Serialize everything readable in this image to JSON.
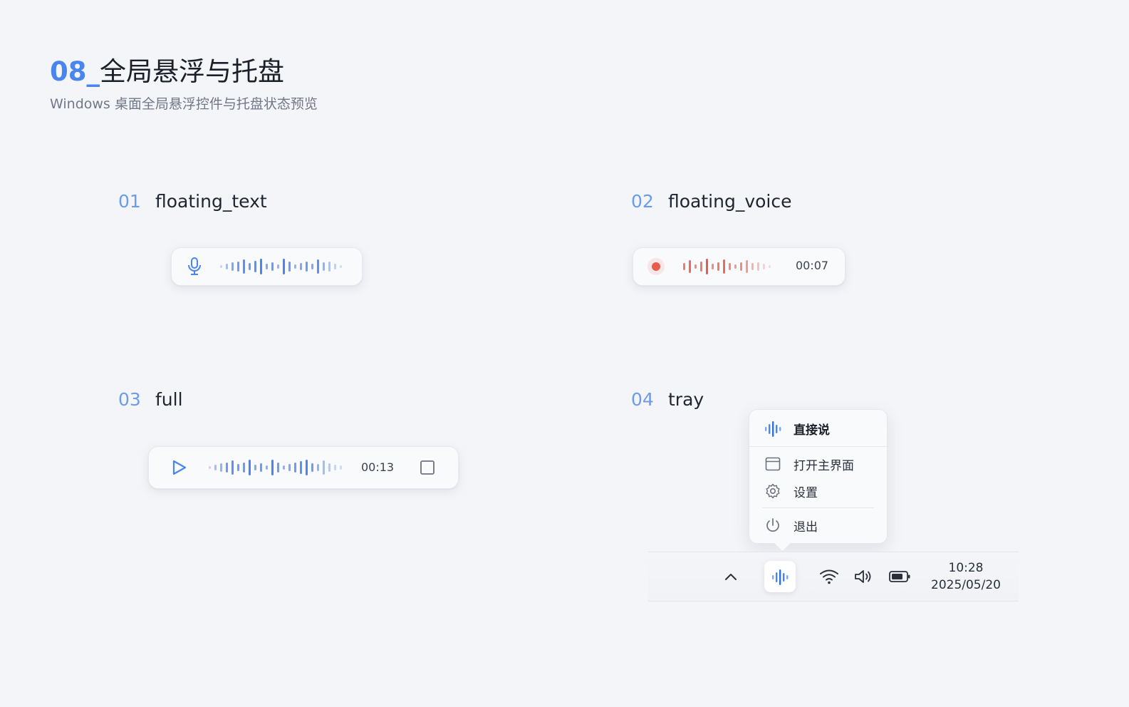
{
  "header": {
    "number": "08_",
    "title": "全局悬浮与托盘",
    "subtitle": "Windows 桌面全局悬浮控件与托盘状态预览"
  },
  "sections": [
    {
      "num": "01",
      "name": "floating_text"
    },
    {
      "num": "02",
      "name": "floating_voice"
    },
    {
      "num": "03",
      "name": "full"
    },
    {
      "num": "04",
      "name": "tray"
    }
  ],
  "floating_text": {
    "mic_icon": "microphone-icon"
  },
  "floating_voice": {
    "record_icon": "record-dot-icon",
    "timer": "00:07"
  },
  "full": {
    "play_icon": "play-icon",
    "timer": "00:13",
    "stop_icon": "stop-square-icon"
  },
  "tray_menu": {
    "header_icon": "voice-wave-icon",
    "header_label": "直接说",
    "items": [
      {
        "label": "打开主界面",
        "icon": "window-icon"
      },
      {
        "label": "设置",
        "icon": "gear-icon"
      },
      {
        "label": "退出",
        "icon": "power-icon"
      }
    ]
  },
  "taskbar": {
    "icons": [
      "chevron-up-icon",
      "voice-wave-icon",
      "wifi-icon",
      "speaker-icon",
      "battery-icon"
    ],
    "clock_time": "10:28",
    "clock_date": "2025/05/20"
  },
  "colors": {
    "accent": "#4a84ee",
    "record": "#e85c4f",
    "background": "#f4f5f8"
  }
}
